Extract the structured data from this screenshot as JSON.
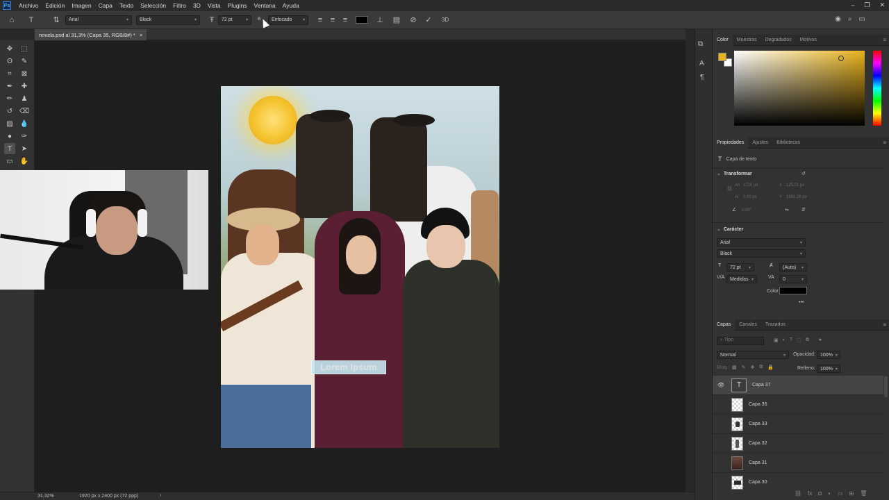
{
  "menu": [
    "Archivo",
    "Edición",
    "Imagen",
    "Capa",
    "Texto",
    "Selección",
    "Filtro",
    "3D",
    "Vista",
    "Plugins",
    "Ventana",
    "Ayuda"
  ],
  "options": {
    "font_family": "Arial",
    "font_style": "Black",
    "font_size": "72 pt",
    "antialias": "Enfocado",
    "text_color": "#000000"
  },
  "document_tab": {
    "title": "novela.psd al 31,3% (Capa 35, RGB/8#) *",
    "close": "×"
  },
  "canvas": {
    "text_layer_placeholder": "Lorem Ipsum"
  },
  "statusbar": {
    "zoom": "31,32%",
    "doc_info": "1920 px x 2400 px (72 ppp)",
    "arrow": "›"
  },
  "color_panel": {
    "tabs": [
      "Color",
      "Muestras",
      "Degradados",
      "Motivos"
    ],
    "foreground": "#e8b21a",
    "background": "#ffffff",
    "hue_color": "#e8b21a"
  },
  "properties_panel": {
    "tabs": [
      "Propiedades",
      "Ajustes",
      "Bibliotecas"
    ],
    "layer_type": "Capa de texto",
    "transform_heading": "Transformar",
    "transform_fields": [
      {
        "label": "An",
        "value": "1720 px"
      },
      {
        "label": "X",
        "value": "125,51 px"
      },
      {
        "label": "Al",
        "value": "0,00 px"
      },
      {
        "label": "Y",
        "value": "1881,26 px"
      },
      {
        "label": "",
        "value": "0,00°"
      }
    ],
    "character_heading": "Carácter",
    "font_family": "Arial",
    "font_style": "Black",
    "font_size": "72 pt",
    "leading": "(Auto)",
    "kerning": "Medidas",
    "tracking": "0",
    "color_label": "Color",
    "color": "#000000",
    "more": "•••"
  },
  "layers_panel": {
    "tabs": [
      "Capas",
      "Canales",
      "Trazados"
    ],
    "search_placeholder": "Tipo",
    "blend_mode": "Normal",
    "opacity_label": "Opacidad:",
    "opacity": "100%",
    "lock_label": "Bloq.:",
    "fill_label": "Relleno:",
    "fill": "100%",
    "layers": [
      {
        "name": "Capa 37",
        "type": "text",
        "selected": true,
        "visible": true
      },
      {
        "name": "Capa 35",
        "type": "pixel",
        "selected": false,
        "visible": false
      },
      {
        "name": "Capa 33",
        "type": "pixel",
        "selected": false,
        "visible": false
      },
      {
        "name": "Capa 32",
        "type": "pixel",
        "selected": false,
        "visible": false
      },
      {
        "name": "Capa 31",
        "type": "photo",
        "selected": false,
        "visible": false
      },
      {
        "name": "Capa 30",
        "type": "pixel",
        "selected": false,
        "visible": false
      }
    ]
  }
}
